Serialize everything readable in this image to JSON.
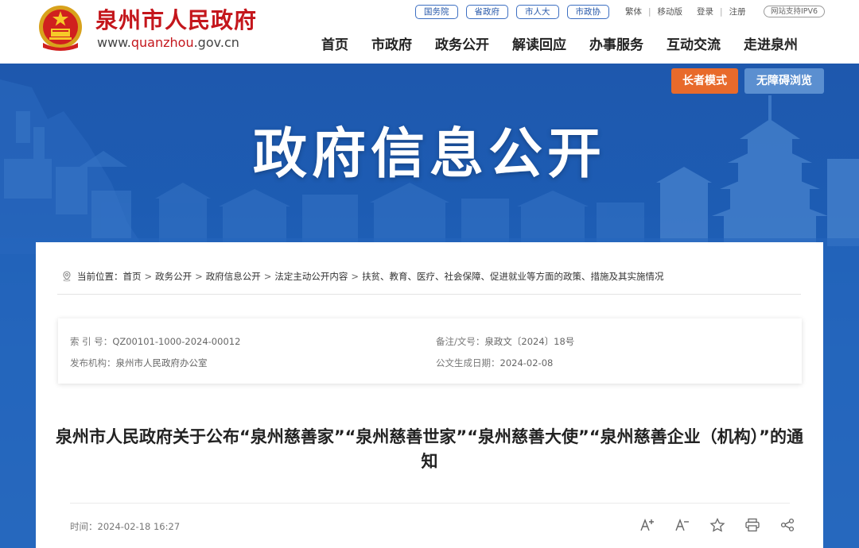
{
  "header": {
    "site_name": "泉州市人民政府",
    "url_prefix": "www.",
    "url_highlight": "quanzhou",
    "url_suffix": ".gov.cn",
    "quick_links": [
      "国务院",
      "省政府",
      "市人大",
      "市政协"
    ],
    "util_links": {
      "traditional": "繁体",
      "mobile": "移动版",
      "login": "登录",
      "register": "注册"
    },
    "ipv6_badge": "网站支持IPV6",
    "nav": [
      "首页",
      "市政府",
      "政务公开",
      "解读回应",
      "办事服务",
      "互动交流",
      "走进泉州"
    ]
  },
  "banner": {
    "title": "政府信息公开",
    "elder_mode": "长者模式",
    "accessible": "无障碍浏览"
  },
  "breadcrumb": {
    "prefix": "当前位置：",
    "items": [
      "首页",
      "政务公开",
      "政府信息公开",
      "法定主动公开内容",
      "扶贫、教育、医疗、社会保障、促进就业等方面的政策、措施及其实施情况"
    ]
  },
  "meta": {
    "index_label": "索 引 号：",
    "index_value": "QZ00101-1000-2024-00012",
    "docno_label": "备注/文号：",
    "docno_value": "泉政文〔2024〕18号",
    "publisher_label": "发布机构：",
    "publisher_value": "泉州市人民政府办公室",
    "created_label": "公文生成日期：",
    "created_value": "2024-02-08"
  },
  "article": {
    "title": "泉州市人民政府关于公布“泉州慈善家”“泉州慈善世家”“泉州慈善大使”“泉州慈善企业（机构）”的通知",
    "time_label": "时间：",
    "time_value": "2024-02-18 16:27"
  },
  "colors": {
    "brand_red": "#c4161c",
    "banner_blue": "#1e58ad",
    "elder_orange": "#e86a2b",
    "access_blue": "#5b8fd0"
  },
  "icons": [
    "national-emblem-icon",
    "location-pin-icon",
    "font-increase-icon",
    "font-decrease-icon",
    "star-icon",
    "print-icon",
    "share-icon"
  ]
}
